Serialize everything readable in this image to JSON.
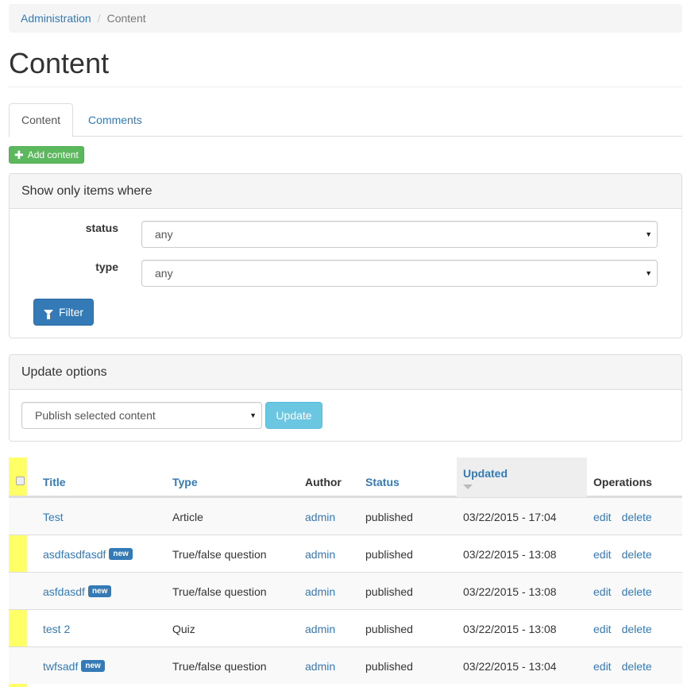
{
  "breadcrumb": {
    "root": "Administration",
    "current": "Content"
  },
  "page_title": "Content",
  "tabs": [
    {
      "label": "Content",
      "active": true
    },
    {
      "label": "Comments",
      "active": false
    }
  ],
  "add_button": "Add content",
  "filter_panel": {
    "heading": "Show only items where",
    "status_label": "status",
    "status_value": "any",
    "type_label": "type",
    "type_value": "any",
    "filter_button": "Filter"
  },
  "update_panel": {
    "heading": "Update options",
    "action_value": "Publish selected content",
    "update_button": "Update"
  },
  "table": {
    "headers": {
      "title": "Title",
      "type": "Type",
      "author": "Author",
      "status": "Status",
      "updated": "Updated",
      "operations": "Operations"
    },
    "rows": [
      {
        "title": "Test",
        "new": false,
        "type": "Article",
        "author": "admin",
        "status": "published",
        "updated": "03/22/2015 - 17:04",
        "edit": "edit",
        "delete": "delete"
      },
      {
        "title": "asdfasdfasdf",
        "new": true,
        "type": "True/false question",
        "author": "admin",
        "status": "published",
        "updated": "03/22/2015 - 13:08",
        "edit": "edit",
        "delete": "delete"
      },
      {
        "title": "asfdasdf",
        "new": true,
        "type": "True/false question",
        "author": "admin",
        "status": "published",
        "updated": "03/22/2015 - 13:08",
        "edit": "edit",
        "delete": "delete"
      },
      {
        "title": "test 2",
        "new": false,
        "type": "Quiz",
        "author": "admin",
        "status": "published",
        "updated": "03/22/2015 - 13:08",
        "edit": "edit",
        "delete": "delete"
      },
      {
        "title": "twfsadf",
        "new": true,
        "type": "True/false question",
        "author": "admin",
        "status": "published",
        "updated": "03/22/2015 - 13:04",
        "edit": "edit",
        "delete": "delete"
      }
    ],
    "new_badge": "new"
  },
  "colors": {
    "link": "#337ab7",
    "success": "#5cb85c",
    "primary": "#337ab7",
    "info": "#5bc0de",
    "highlight": "#ffff66"
  }
}
